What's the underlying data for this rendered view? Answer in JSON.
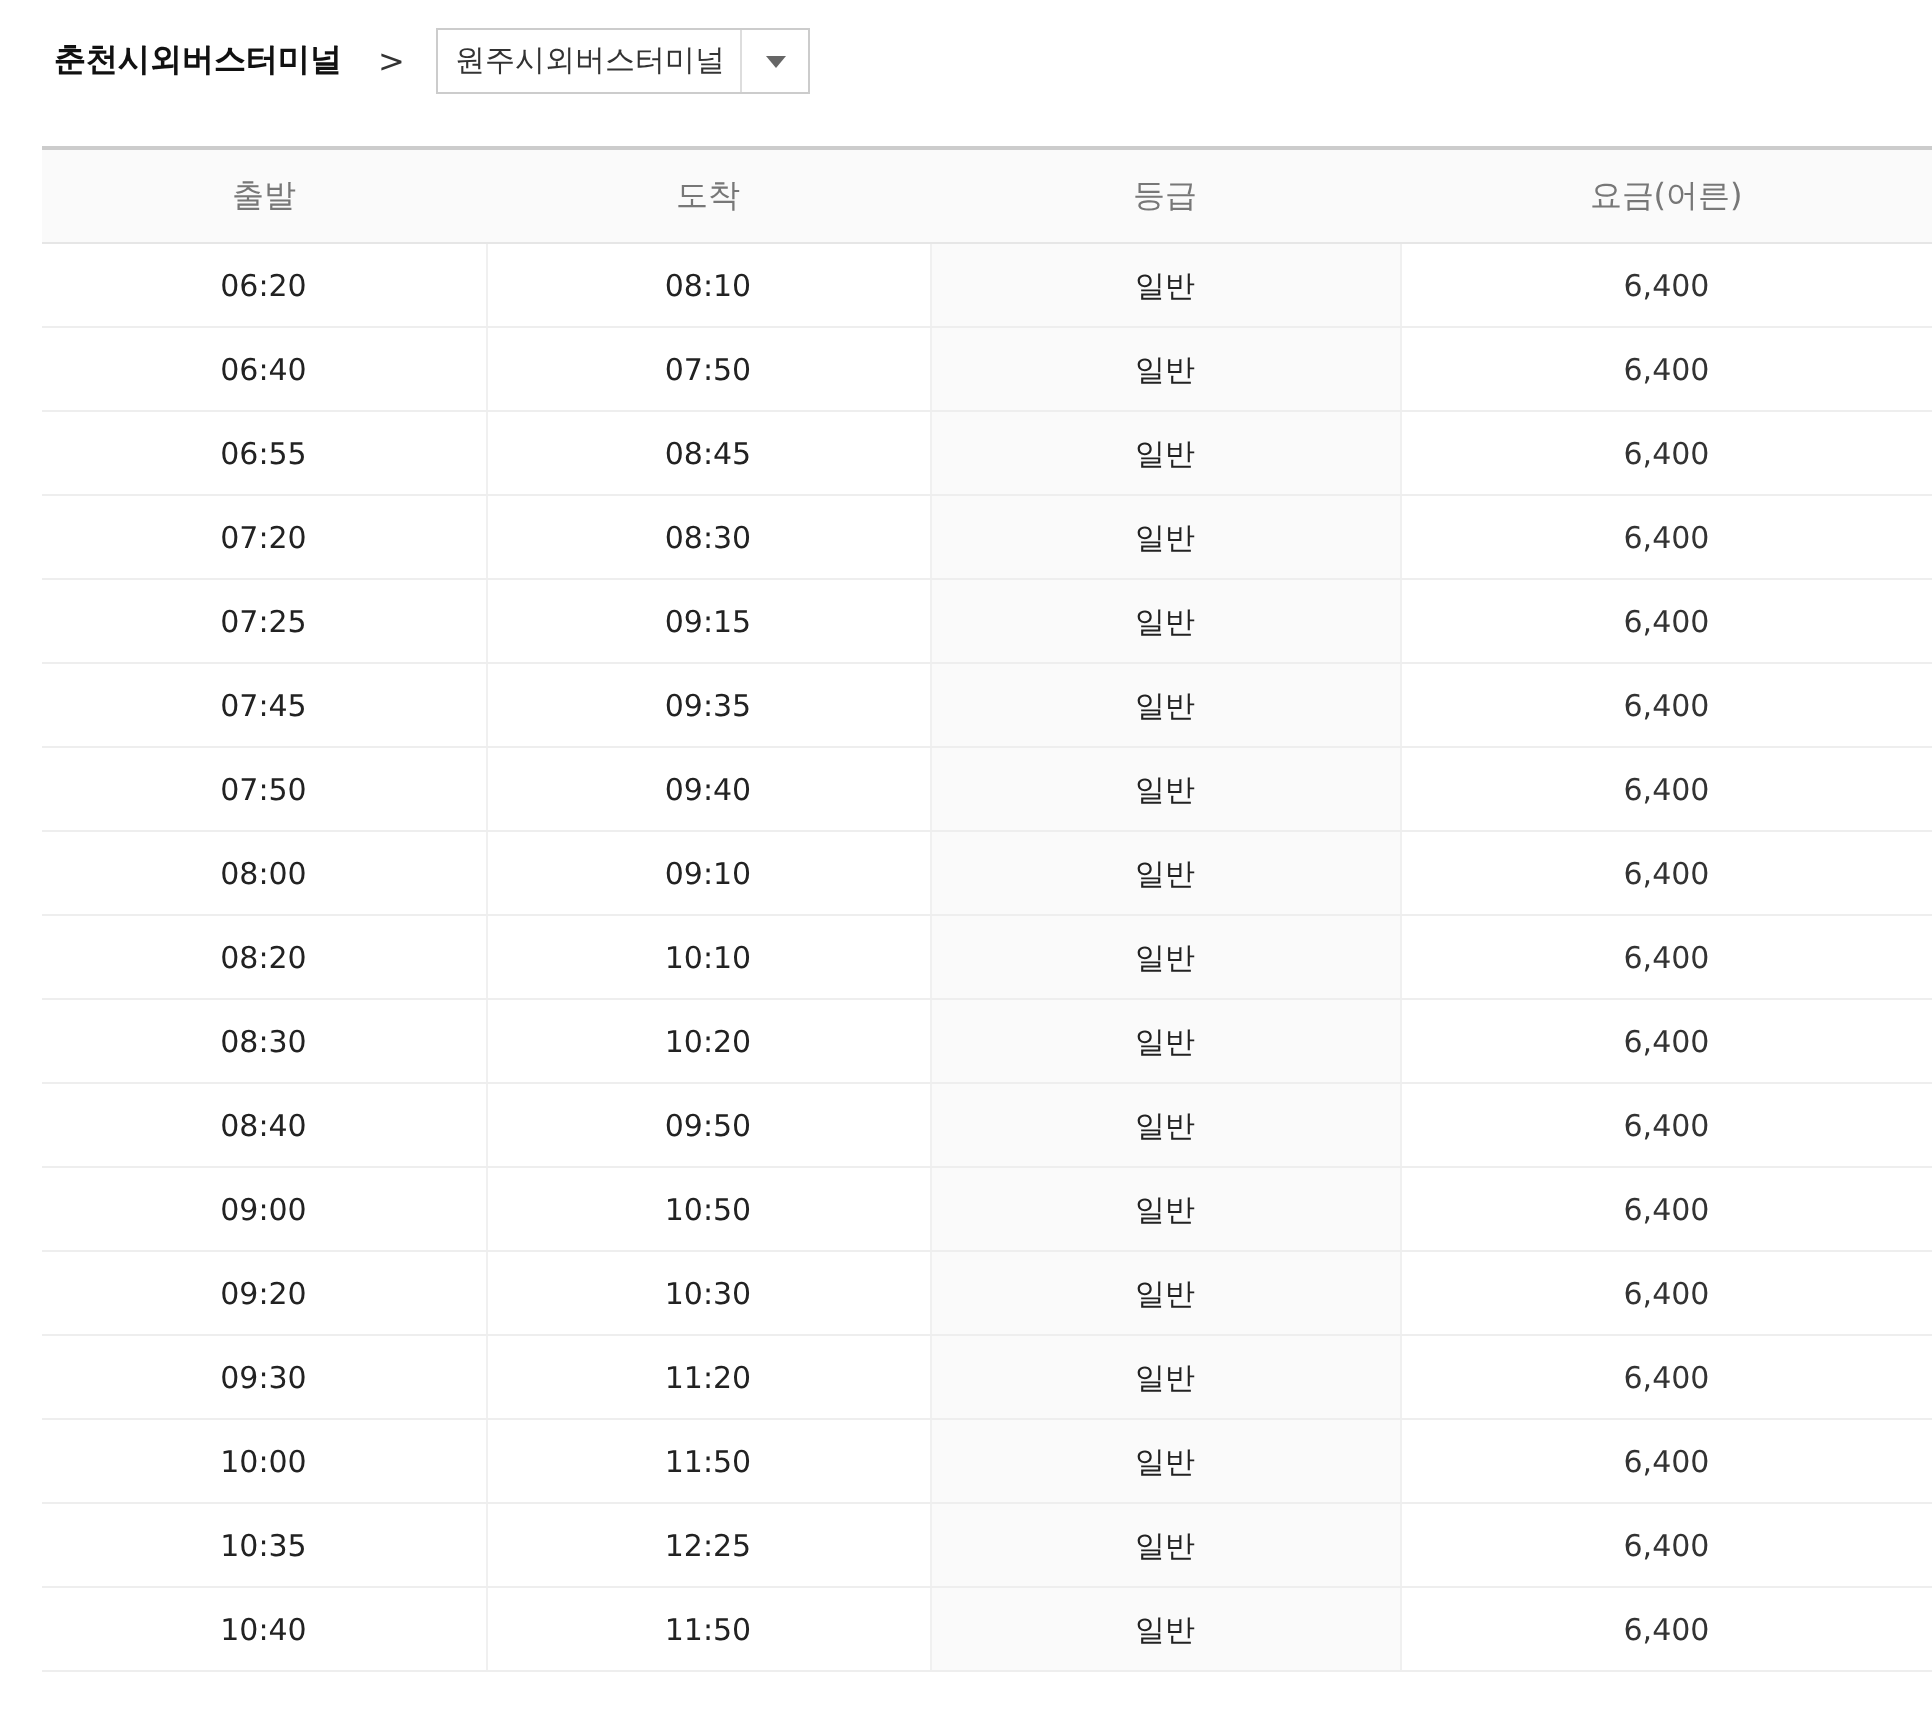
{
  "route": {
    "origin": "춘천시외버스터미널",
    "separator": ">",
    "destination": "원주시외버스터미널"
  },
  "table": {
    "columns": [
      "출발",
      "도착",
      "등급",
      "요금(어른)"
    ],
    "rows": [
      [
        "06:20",
        "08:10",
        "일반",
        "6,400"
      ],
      [
        "06:40",
        "07:50",
        "일반",
        "6,400"
      ],
      [
        "06:55",
        "08:45",
        "일반",
        "6,400"
      ],
      [
        "07:20",
        "08:30",
        "일반",
        "6,400"
      ],
      [
        "07:25",
        "09:15",
        "일반",
        "6,400"
      ],
      [
        "07:45",
        "09:35",
        "일반",
        "6,400"
      ],
      [
        "07:50",
        "09:40",
        "일반",
        "6,400"
      ],
      [
        "08:00",
        "09:10",
        "일반",
        "6,400"
      ],
      [
        "08:20",
        "10:10",
        "일반",
        "6,400"
      ],
      [
        "08:30",
        "10:20",
        "일반",
        "6,400"
      ],
      [
        "08:40",
        "09:50",
        "일반",
        "6,400"
      ],
      [
        "09:00",
        "10:50",
        "일반",
        "6,400"
      ],
      [
        "09:20",
        "10:30",
        "일반",
        "6,400"
      ],
      [
        "09:30",
        "11:20",
        "일반",
        "6,400"
      ],
      [
        "10:00",
        "11:50",
        "일반",
        "6,400"
      ],
      [
        "10:35",
        "12:25",
        "일반",
        "6,400"
      ],
      [
        "10:40",
        "11:50",
        "일반",
        "6,400"
      ]
    ]
  }
}
